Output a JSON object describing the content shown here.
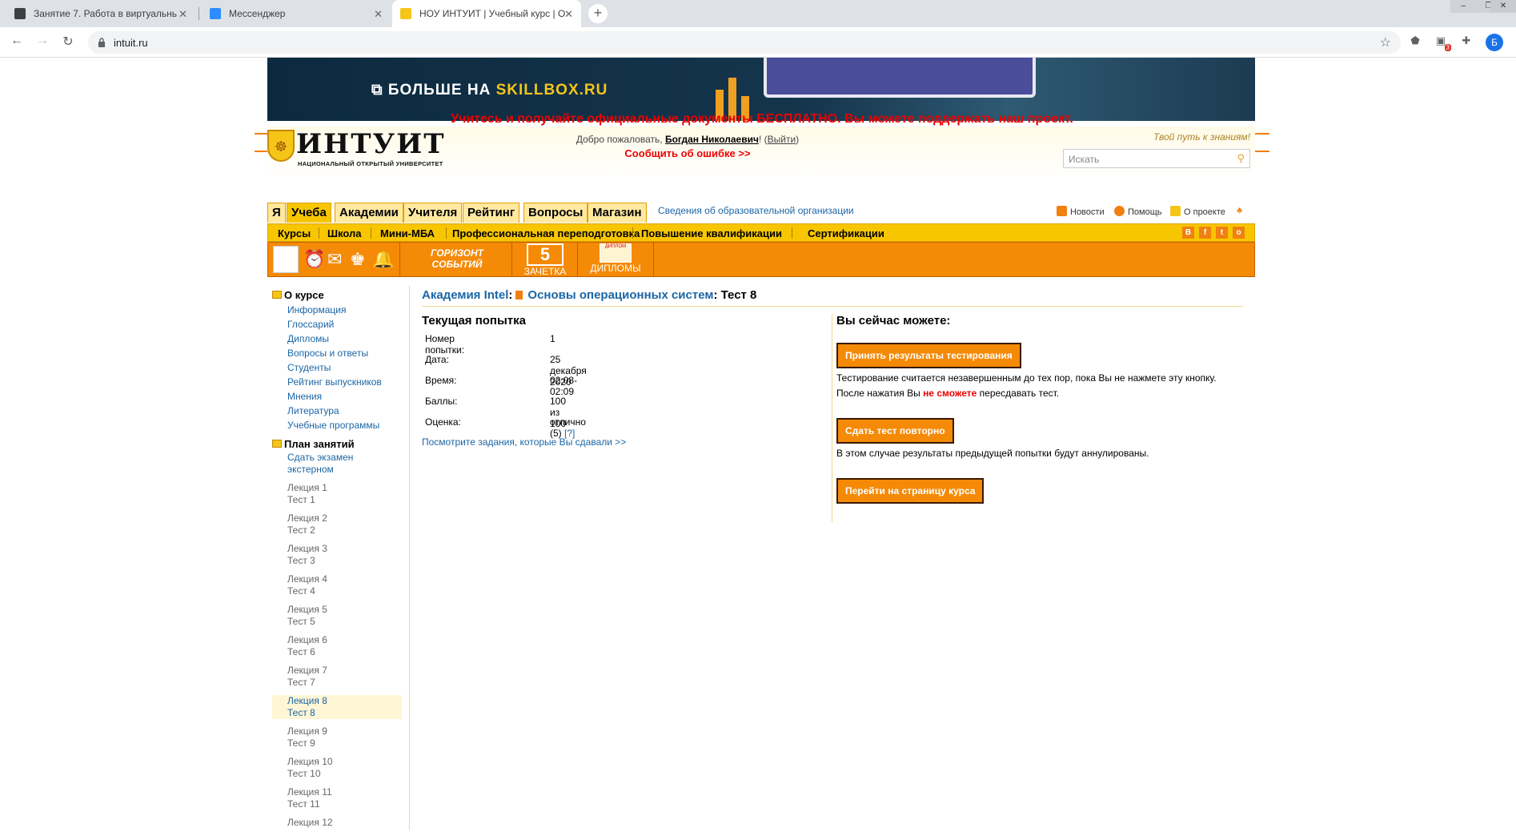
{
  "browser": {
    "tabs": [
      {
        "title": "Занятие 7. Работа в виртуальнь",
        "icon": "classroom-icon"
      },
      {
        "title": "Мессенджер",
        "icon": "messenger-icon"
      },
      {
        "title": "НОУ ИНТУИТ | Учебный курс | О",
        "icon": "intuit-icon"
      }
    ],
    "url": "intuit.ru",
    "profile_initial": "Б",
    "ext_badge": "3"
  },
  "banner": {
    "prefix": "БОЛЬШЕ НА",
    "highlight": "SKILLBOX.RU"
  },
  "notice": "Учитесь и получайте официальные документы БЕСПЛАТНО. Вы можете поддержать наш проект.",
  "header": {
    "logo_word": "ИНТУИТ",
    "logo_sub": "НАЦИОНАЛЬНЫЙ ОТКРЫТЫЙ УНИВЕРСИТЕТ",
    "welcome_prefix": "Добро пожаловать,",
    "user_name": "Богдан Николаевич",
    "logout": "Выйти",
    "report": "Сообщить об ошибке >>",
    "tagline": "Твой путь к знаниям!",
    "search_placeholder": "Искать",
    "org_link": "Сведения об образовательной организации",
    "links": [
      "Новости",
      "Помощь",
      "О проекте"
    ]
  },
  "nav_tabs": [
    "Я",
    "Учеба",
    "Академии",
    "Учителя",
    "Рейтинг",
    "Вопросы",
    "Магазин"
  ],
  "active_tab": "Учеба",
  "subnav": [
    "Курсы",
    "Школа",
    "Мини-МБА",
    "Профессиональная переподготовка",
    "Повышение квалификации",
    "Сертификации"
  ],
  "social": [
    "В",
    "f",
    "t",
    "о"
  ],
  "orange_bar": {
    "horizon": "ГОРИЗОНТ СОБЫТИЙ",
    "record": "ЗАЧЕТКА",
    "record_num": "5",
    "diplomas": "ДИПЛОМЫ",
    "diploma_badge": "ДИПЛОМ"
  },
  "sidebar": {
    "about_title": "О курсе",
    "about_links": [
      "Информация",
      "Глоссарий",
      "Дипломы",
      "Вопросы и ответы",
      "Студенты",
      "Рейтинг выпускников",
      "Мнения",
      "Литература",
      "Учебные программы"
    ],
    "plan_title": "План занятий",
    "exam_link": "Сдать экзамен экстерном",
    "lectures": [
      {
        "lecture": "Лекция 1",
        "test": "Тест 1"
      },
      {
        "lecture": "Лекция 2",
        "test": "Тест 2"
      },
      {
        "lecture": "Лекция 3",
        "test": "Тест 3"
      },
      {
        "lecture": "Лекция 4",
        "test": "Тест 4"
      },
      {
        "lecture": "Лекция 5",
        "test": "Тест 5"
      },
      {
        "lecture": "Лекция 6",
        "test": "Тест 6"
      },
      {
        "lecture": "Лекция 7",
        "test": "Тест 7"
      },
      {
        "lecture": "Лекция 8",
        "test": "Тест 8"
      },
      {
        "lecture": "Лекция 9",
        "test": "Тест 9"
      },
      {
        "lecture": "Лекция 10",
        "test": "Тест 10"
      },
      {
        "lecture": "Лекция 11",
        "test": "Тест 11"
      },
      {
        "lecture": "Лекция 12",
        "test": ""
      }
    ]
  },
  "breadcrumb": {
    "academy": "Академия Intel",
    "course": "Основы операционных систем",
    "test": "Тест 8"
  },
  "attempt": {
    "title": "Текущая попытка",
    "rows": [
      {
        "k": "Номер попытки:",
        "v": "1"
      },
      {
        "k": "Дата:",
        "v": "25 декабря 2020"
      },
      {
        "k": "Время:",
        "v": "02:08-02:09"
      },
      {
        "k": "Баллы:",
        "v": "100 из 100"
      },
      {
        "k": "Оценка:",
        "v": "отлично (5)",
        "q": "[?]"
      }
    ],
    "view_link": "Посмотрите задания, которые Вы сдавали >>"
  },
  "actions": {
    "title": "Вы сейчас можете:",
    "accept": "Принять результаты тестирования",
    "accept_note1": "Тестирование считается незавершенным до тех пор, пока Вы не нажмете эту кнопку.",
    "accept_note2a": "После нажатия Вы",
    "accept_note2b": "не сможете",
    "accept_note2c": "пересдавать тест.",
    "retry": "Сдать тест повторно",
    "retry_note": "В этом случае результаты предыдущей попытки будут аннулированы.",
    "course": "Перейти на страницу курса"
  },
  "colors": {
    "accent_orange": "#f58a07",
    "accent_yellow": "#f7c600",
    "link_blue": "#1b66a6",
    "alert_red": "#e00000"
  }
}
